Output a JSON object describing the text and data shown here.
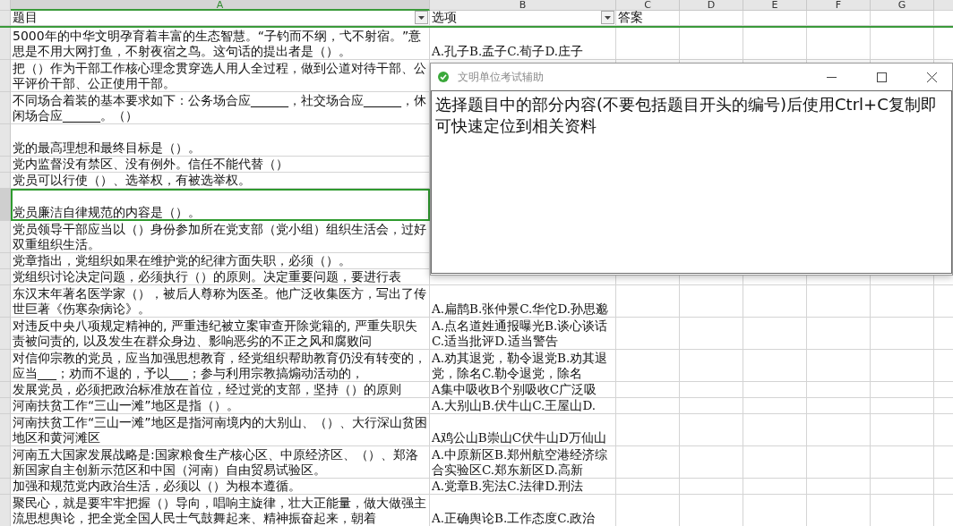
{
  "sheet": {
    "columns": [
      {
        "label": "A",
        "selected": true
      },
      {
        "label": "B",
        "selected": false
      },
      {
        "label": "C",
        "selected": false
      },
      {
        "label": "D",
        "selected": false
      },
      {
        "label": "E",
        "selected": false
      },
      {
        "label": "F",
        "selected": false
      },
      {
        "label": "G",
        "selected": false
      }
    ],
    "header_row": [
      {
        "text": "题目",
        "filter": true
      },
      {
        "text": "选项",
        "filter": true
      },
      {
        "text": "答案",
        "filter": false
      }
    ],
    "rows": [
      {
        "a": "5000年的中华文明孕育着丰富的生态智慧。“子钓而不纲，弋不射宿。”意思是不用大网打鱼，不射夜宿之鸟。这句话的提出者是（）。",
        "b": "A.孔子B.孟子C.荀子D.庄子",
        "tall": true,
        "selected": false
      },
      {
        "a": "把（）作为干部工作核心理念贯穿选人用人全过程，做到公道对待干部、公平评价干部、公正使用干部。",
        "tall": true,
        "selected": false
      },
      {
        "a": "不同场合着装的基本要求如下：公务场合应______，社交场合应______，休闲场合应______。（）",
        "tall": true,
        "selected": false
      },
      {
        "a": "党的最高理想和最终目标是（）。",
        "tall": true,
        "selected": false
      },
      {
        "a": "党内监督没有禁区、没有例外。信任不能代替（）",
        "tall": false,
        "selected": false
      },
      {
        "a": "党员可以行使（）、选举权，有被选举权。",
        "tall": false,
        "selected": false
      },
      {
        "a": "党员廉洁自律规范的内容是（）。",
        "tall": true,
        "selected": true
      },
      {
        "a": "党员领导干部应当以（）身份参加所在党支部（党小组）组织生活会，过好双重组织生活。",
        "tall": true,
        "selected": false
      },
      {
        "a": "党章指出，党组织如果在维护党的纪律方面失职，必须（）。",
        "tall": false,
        "selected": false
      },
      {
        "a": "党组织讨论决定问题，必须执行（）的原则。决定重要问题，要进行表",
        "tall": false,
        "selected": false
      },
      {
        "a": "东汉末年著名医学家（），被后人尊称为医圣。他广泛收集医方，写出了传世巨著《伤寒杂病论》。",
        "b": "A.扁鹊B.张仲景C.华佗D.孙思邈",
        "tall": true,
        "selected": false
      },
      {
        "a": "对违反中央八项规定精神的, 严重违纪被立案审查开除党籍的, 严重失职失责被问责的, 以及发生在群众身边、影响恶劣的不正之风和腐败问",
        "b": "A.点名道姓通报曝光B.谈心谈话C.适当批评D.适当警告",
        "tall": true,
        "selected": false
      },
      {
        "a": "对信仰宗教的党员，应当加强思想教育，经党组织帮助教育仍没有转变的，应当___；劝而不退的，予以___；参与利用宗教搞煽动活动的，",
        "b": "A.劝其退党，勒令退党B.劝其退党，除名C.勒令退党，除名",
        "tall": true,
        "selected": false
      },
      {
        "a": "发展党员，必须把政治标准放在首位，经过党的支部，坚持（）的原则",
        "b": "A集中吸收B个别吸收C广泛吸",
        "tall": false,
        "selected": false
      },
      {
        "a": "河南扶贫工作“三山一滩”地区是指（）。",
        "b": "A.大别山B.伏牛山C.王屋山D.",
        "tall": false,
        "selected": false
      },
      {
        "a": "河南扶贫工作“三山一滩”地区是指河南境内的大别山、（）、大行深山贫困地区和黄河滩区",
        "b": "A鸡公山B崇山C伏牛山D万仙山",
        "tall": true,
        "selected": false
      },
      {
        "a": "河南五大国家发展战略是:国家粮食生产核心区、中原经济区、（）、郑洛新国家自主创新示范区和中国（河南）自由贸易试验区。",
        "b": "A.中原新区B.郑州航空港经济综合实验区C.郑东新区D.高新",
        "tall": true,
        "selected": false
      },
      {
        "a": "加强和规范党内政治生活，必须以（）为根本遵循。",
        "b": "A.党章B.宪法C.法律D.刑法",
        "tall": false,
        "selected": false
      },
      {
        "a": "聚民心，就是要牢牢把握（）导向，唱响主旋律，壮大正能量，做大做强主流思想舆论，把全党全国人民士气鼓舞起来、精神振奋起来，朝着",
        "b": "A.正确舆论B.工作态度C.政治",
        "tall": true,
        "selected": false
      }
    ]
  },
  "dialog": {
    "title": "文明单位考试辅助",
    "message": "选择题目中的部分内容(不要包括题目开头的编号)后使用Ctrl+C复制即可快速定位到相关资料"
  }
}
